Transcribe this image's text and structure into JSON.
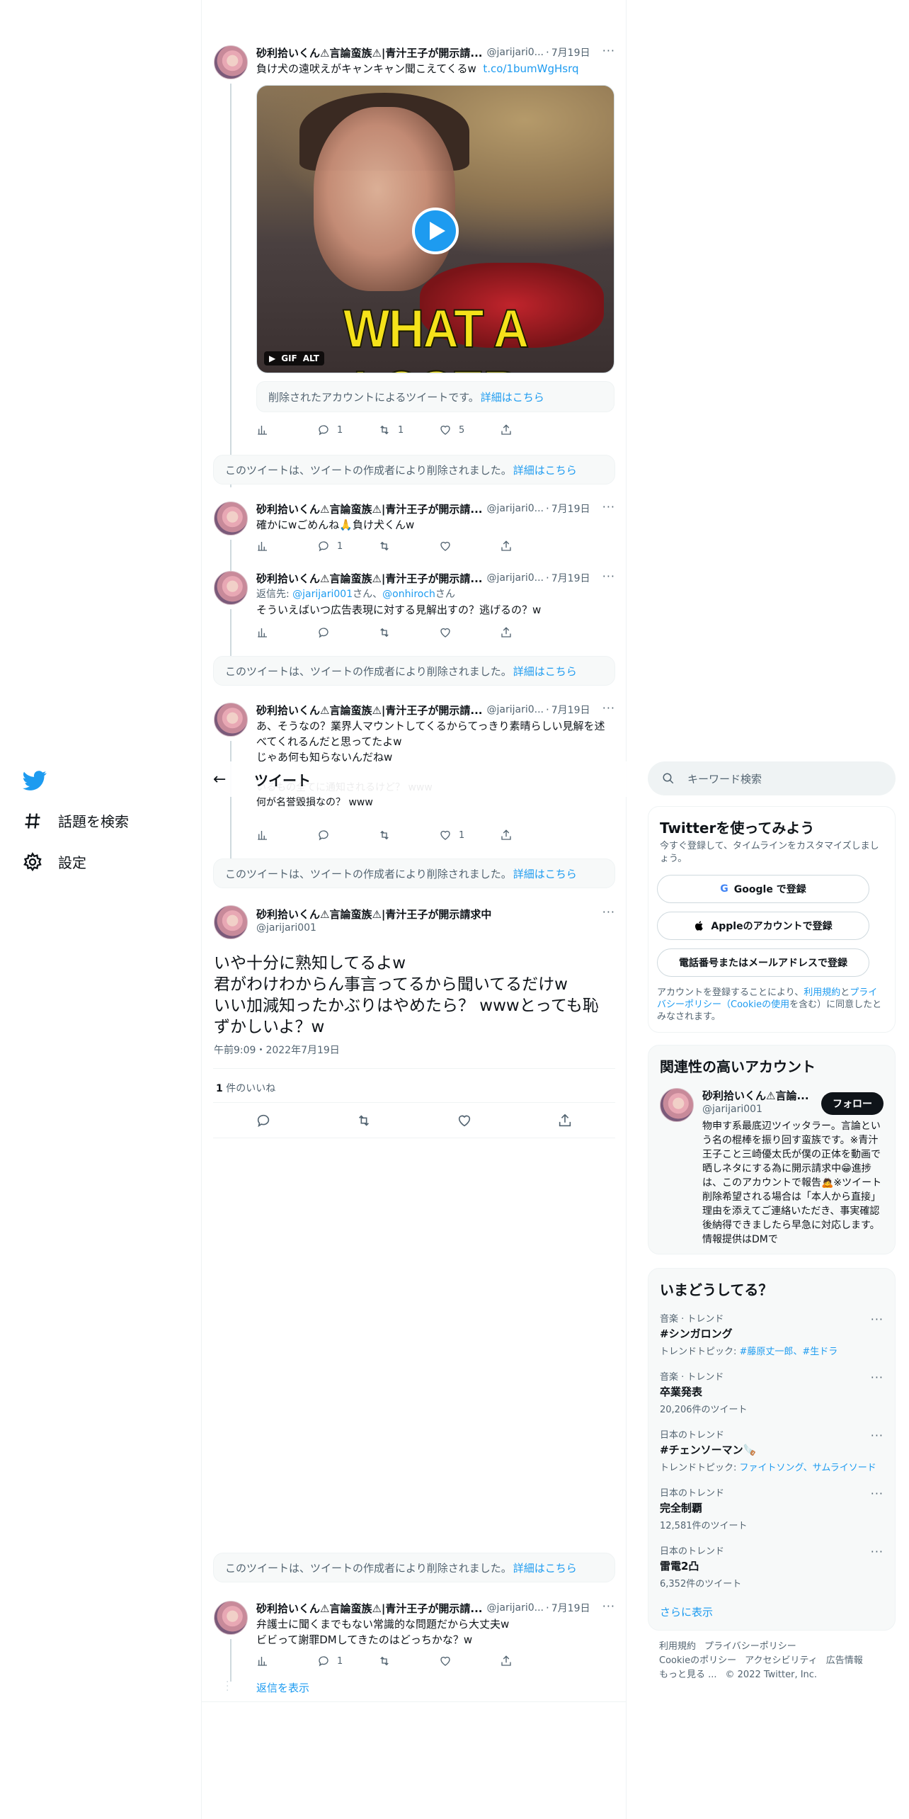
{
  "nav": {
    "items": [
      {
        "label": "話題を検索"
      },
      {
        "label": "設定"
      }
    ]
  },
  "header": {
    "title": "ツイート"
  },
  "common": {
    "name": "砂利拾いくん⚠言論蛮族⚠|青汁王子が開示請...",
    "handle": "@jarijari0...",
    "date": "7月19日",
    "dot": "·",
    "more": "···",
    "deleted_text": "このツイートは、ツイートの作成者により削除されました。",
    "deleted_link": "詳細はこちら"
  },
  "tweets": [
    {
      "text": "負け犬の遠吠えがキャンキャン聞こえてくるw",
      "link": "t.co/1bumWgHsrq",
      "reply": "1",
      "retweet": "1",
      "like": "5",
      "media": {
        "caption": "WHAT A LOSER",
        "gif": "GIF",
        "alt": "ALT"
      },
      "quote_deleted": "削除されたアカウントによるツイートです。",
      "quote_link": "詳細はこちら"
    },
    {
      "text": "確かにwごめんね🙏負け犬くんw",
      "reply": "1",
      "retweet": "",
      "like": ""
    },
    {
      "reply_to_prefix": "返信先: ",
      "reply_to_1": "@jarijari001",
      "reply_to_mid": "さん、",
      "reply_to_2": "@onhiroch",
      "reply_to_suffix": "さん",
      "text": "そういえばいつ広告表現に対する見解出すの？逃げるの？w",
      "reply": "",
      "retweet": "",
      "like": ""
    },
    {
      "text": "あ、そうなの？業界人マウントしてくるからてっきり素晴らしい見解を述べてくれるんだと思ってたよw\nじゃあ何も知らないんだねw",
      "hidden_text": "いるもの全てに通知されるけど？ www\n何が名誉毀損なの？ www",
      "reply": "",
      "retweet": "",
      "like": "1"
    }
  ],
  "focus": {
    "name": "砂利拾いくん⚠言論蛮族⚠|青汁王子が開示請求中",
    "handle": "@jarijari001",
    "text": "いや十分に熟知してるよw\n君がわけわからん事言ってるから聞いてるだけw\nいい加減知ったかぶりはやめたら？ wwwとっても恥ずかしいよ？w",
    "time": "午前9:09・2022年7月19日",
    "likes_count": "1",
    "likes_label": "件のいいね"
  },
  "last_tweet": {
    "text": "弁護士に聞くまでもない常識的な問題だから大丈夫w\nビビって謝罪DMしてきたのはどっちかな？w",
    "reply": "1",
    "retweet": "",
    "like": "",
    "show_replies": "返信を表示"
  },
  "right": {
    "search_placeholder": "キーワード検索",
    "signup": {
      "title": "Twitterを使ってみよう",
      "desc": "今すぐ登録して、タイムラインをカスタマイズしましょう。",
      "google": "Google で登録",
      "apple": "Appleのアカウントで登録",
      "phone": "電話番号またはメールアドレスで登録",
      "terms_1": "アカウントを登録することにより、",
      "terms_link1": "利用規約",
      "terms_2": "と",
      "terms_link2": "プライバシーポリシー（Cookieの使用",
      "terms_3": "を含む）に同意したとみなされます。"
    },
    "related": {
      "title": "関連性の高いアカウント",
      "name": "砂利拾いくん⚠言論...",
      "handle": "@jarijari001",
      "follow": "フォロー",
      "bio": "物申す系最底辺ツイッタラー。言論という名の棍棒を振り回す蛮族です。※青汁王子こと三崎優太氏が僕の正体を動画で晒しネタにする為に開示請求中😁進捗は、このアカウントで報告🙇※ツイート削除希望される場合は「本人から直接」理由を添えてご連絡いただき、事実確認後納得できましたら早急に対応します。情報提供はDMで"
    },
    "trends": {
      "title": "いまどうしてる？",
      "items": [
        {
          "meta": "音楽 · トレンド",
          "name": "#シンガロング",
          "sub_prefix": "トレンドトピック: ",
          "sub_link": "#藤原丈一郎、#生ドラ"
        },
        {
          "meta": "音楽 · トレンド",
          "name": "卒業発表",
          "sub": "20,206件のツイート"
        },
        {
          "meta": "日本のトレンド",
          "name": "#チェンソーマン🪚",
          "sub_prefix": "トレンドトピック: ",
          "sub_link": "ファイトソング、サムライソード"
        },
        {
          "meta": "日本のトレンド",
          "name": "完全制覇",
          "sub": "12,581件のツイート"
        },
        {
          "meta": "日本のトレンド",
          "name": "雷電2凸",
          "sub": "6,352件のツイート"
        }
      ],
      "more": "さらに表示"
    },
    "footer": [
      "利用規約",
      "プライバシーポリシー",
      "Cookieのポリシー",
      "アクセシビリティ",
      "広告情報",
      "もっと見る ...",
      "© 2022 Twitter, Inc."
    ]
  },
  "colors": {
    "accent": "#1d9bf0",
    "text": "#0f1419",
    "muted": "#536471"
  }
}
